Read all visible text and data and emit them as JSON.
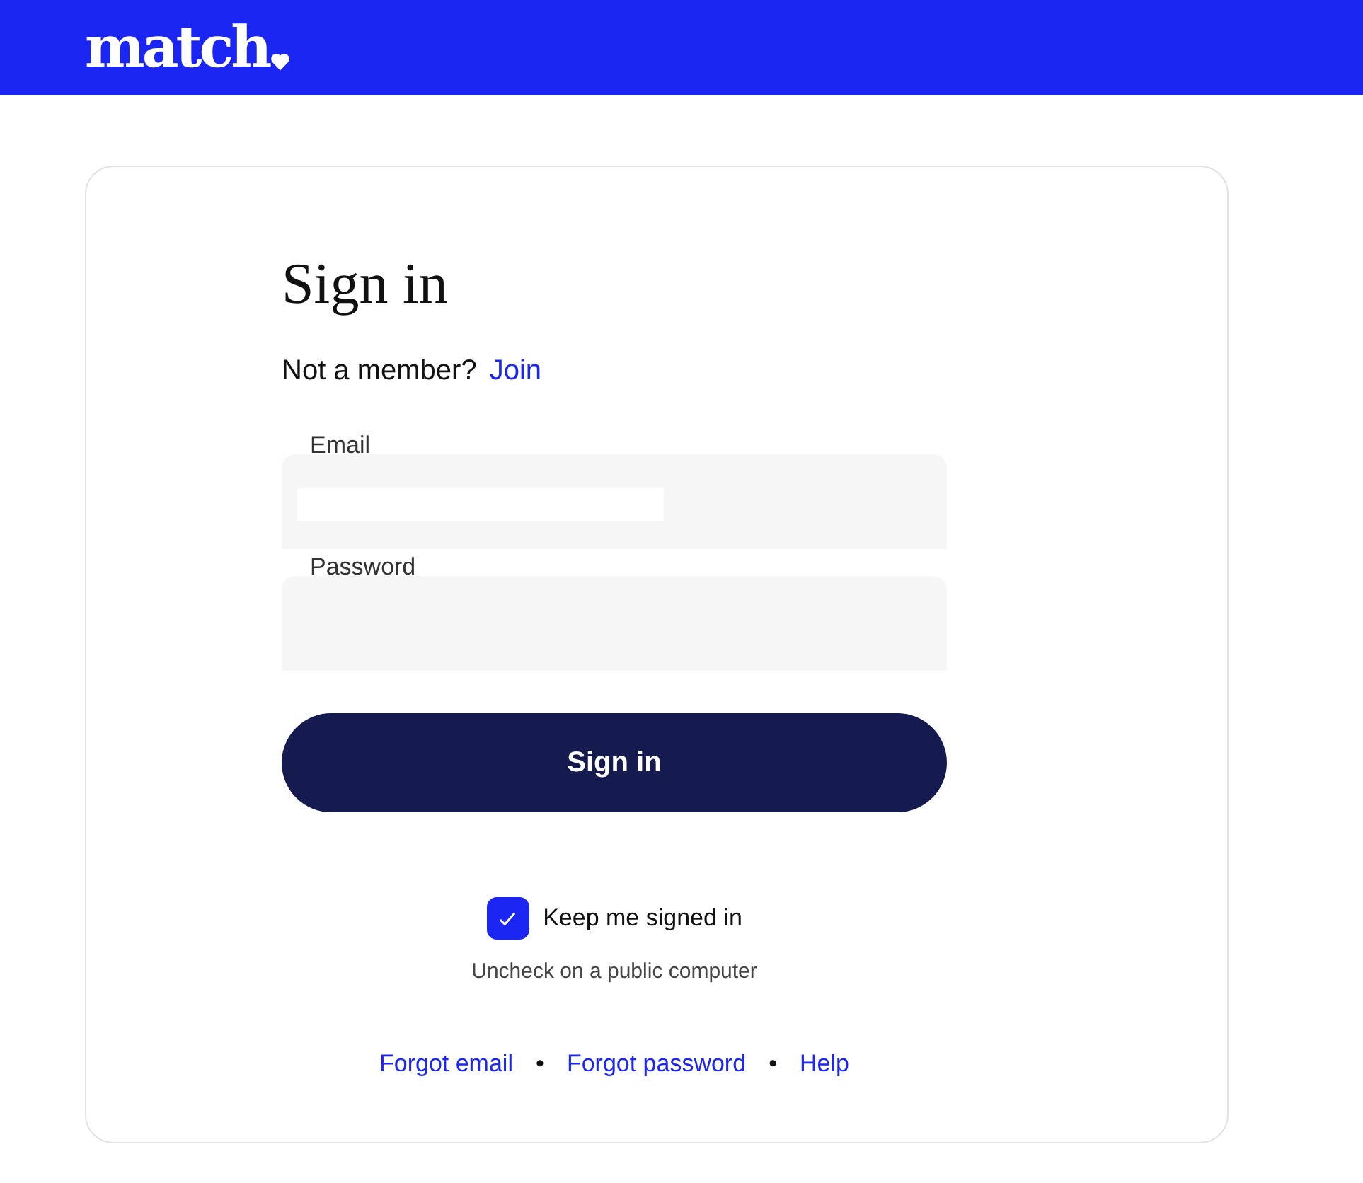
{
  "header": {
    "logo": "match"
  },
  "form": {
    "title": "Sign in",
    "prompt": "Not a member?",
    "join_link": "Join",
    "fields": [
      {
        "label": "Email",
        "kind": "text"
      },
      {
        "label": "Password",
        "kind": "password"
      }
    ],
    "submit": "Sign in",
    "keep_signed_in": {
      "label": "Keep me signed in",
      "checked": true
    },
    "note": "Uncheck on a public computer",
    "links": [
      {
        "label": "Forgot email"
      },
      {
        "label": "Forgot password"
      },
      {
        "label": "Help"
      }
    ],
    "separator": "•"
  }
}
